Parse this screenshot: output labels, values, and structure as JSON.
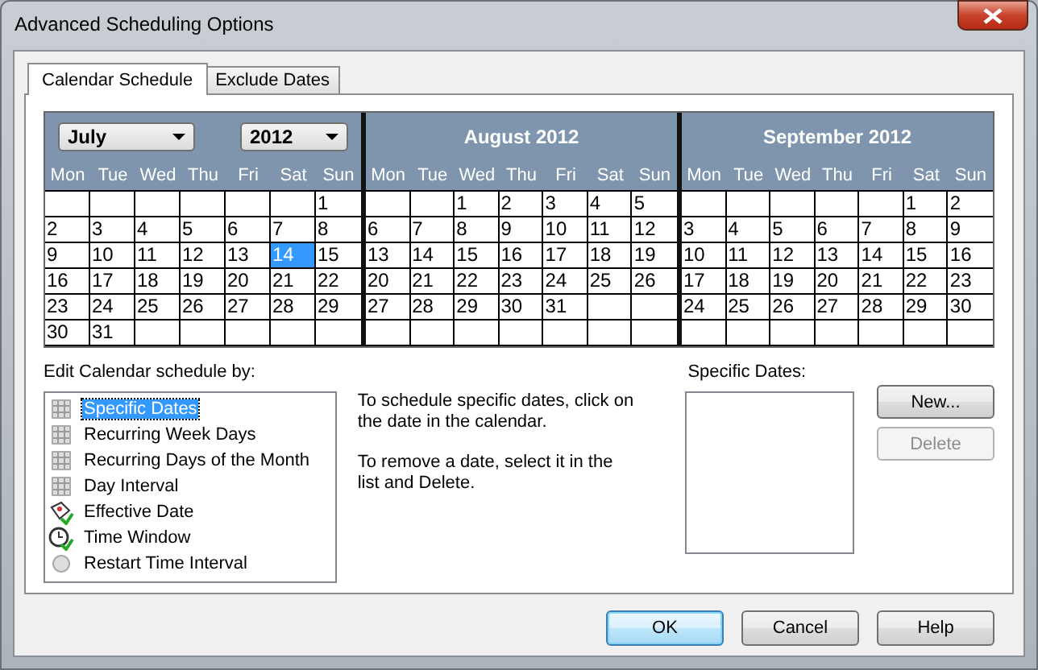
{
  "window": {
    "title": "Advanced Scheduling Options"
  },
  "tabs": [
    {
      "label": "Calendar Schedule",
      "selected": true
    },
    {
      "label": "Exclude Dates",
      "selected": false
    }
  ],
  "calendar": {
    "months": [
      {
        "kind": "dropdowns",
        "month_select": "July",
        "year_select": "2012",
        "weekdays": [
          "Mon",
          "Tue",
          "Wed",
          "Thu",
          "Fri",
          "Sat",
          "Sun"
        ],
        "weeks": [
          [
            {
              "kind": "blank"
            },
            {
              "kind": "blank"
            },
            {
              "kind": "blank"
            },
            {
              "kind": "blank"
            },
            {
              "kind": "blank"
            },
            {
              "kind": "blank"
            },
            {
              "kind": "day",
              "day": "1",
              "selected": false
            }
          ],
          [
            {
              "kind": "day",
              "day": "2",
              "selected": false
            },
            {
              "kind": "day",
              "day": "3",
              "selected": false
            },
            {
              "kind": "day",
              "day": "4",
              "selected": false
            },
            {
              "kind": "day",
              "day": "5",
              "selected": false
            },
            {
              "kind": "day",
              "day": "6",
              "selected": false
            },
            {
              "kind": "day",
              "day": "7",
              "selected": false
            },
            {
              "kind": "day",
              "day": "8",
              "selected": false
            }
          ],
          [
            {
              "kind": "day",
              "day": "9",
              "selected": false
            },
            {
              "kind": "day",
              "day": "10",
              "selected": false
            },
            {
              "kind": "day",
              "day": "11",
              "selected": false
            },
            {
              "kind": "day",
              "day": "12",
              "selected": false
            },
            {
              "kind": "day",
              "day": "13",
              "selected": false
            },
            {
              "kind": "day",
              "day": "14",
              "selected": true
            },
            {
              "kind": "day",
              "day": "15",
              "selected": false
            }
          ],
          [
            {
              "kind": "day",
              "day": "16",
              "selected": false
            },
            {
              "kind": "day",
              "day": "17",
              "selected": false
            },
            {
              "kind": "day",
              "day": "18",
              "selected": false
            },
            {
              "kind": "day",
              "day": "19",
              "selected": false
            },
            {
              "kind": "day",
              "day": "20",
              "selected": false
            },
            {
              "kind": "day",
              "day": "21",
              "selected": false
            },
            {
              "kind": "day",
              "day": "22",
              "selected": false
            }
          ],
          [
            {
              "kind": "day",
              "day": "23",
              "selected": false
            },
            {
              "kind": "day",
              "day": "24",
              "selected": false
            },
            {
              "kind": "day",
              "day": "25",
              "selected": false
            },
            {
              "kind": "day",
              "day": "26",
              "selected": false
            },
            {
              "kind": "day",
              "day": "27",
              "selected": false
            },
            {
              "kind": "day",
              "day": "28",
              "selected": false
            },
            {
              "kind": "day",
              "day": "29",
              "selected": false
            }
          ],
          [
            {
              "kind": "day",
              "day": "30",
              "selected": false
            },
            {
              "kind": "day",
              "day": "31",
              "selected": false
            },
            {
              "kind": "blank"
            },
            {
              "kind": "blank"
            },
            {
              "kind": "blank"
            },
            {
              "kind": "blank"
            },
            {
              "kind": "blank"
            }
          ]
        ]
      },
      {
        "kind": "title",
        "title": "August 2012",
        "weekdays": [
          "Mon",
          "Tue",
          "Wed",
          "Thu",
          "Fri",
          "Sat",
          "Sun"
        ],
        "weeks": [
          [
            {
              "kind": "blank"
            },
            {
              "kind": "blank"
            },
            {
              "kind": "day",
              "day": "1",
              "selected": false
            },
            {
              "kind": "day",
              "day": "2",
              "selected": false
            },
            {
              "kind": "day",
              "day": "3",
              "selected": false
            },
            {
              "kind": "day",
              "day": "4",
              "selected": false
            },
            {
              "kind": "day",
              "day": "5",
              "selected": false
            }
          ],
          [
            {
              "kind": "day",
              "day": "6",
              "selected": false
            },
            {
              "kind": "day",
              "day": "7",
              "selected": false
            },
            {
              "kind": "day",
              "day": "8",
              "selected": false
            },
            {
              "kind": "day",
              "day": "9",
              "selected": false
            },
            {
              "kind": "day",
              "day": "10",
              "selected": false
            },
            {
              "kind": "day",
              "day": "11",
              "selected": false
            },
            {
              "kind": "day",
              "day": "12",
              "selected": false
            }
          ],
          [
            {
              "kind": "day",
              "day": "13",
              "selected": false
            },
            {
              "kind": "day",
              "day": "14",
              "selected": false
            },
            {
              "kind": "day",
              "day": "15",
              "selected": false
            },
            {
              "kind": "day",
              "day": "16",
              "selected": false
            },
            {
              "kind": "day",
              "day": "17",
              "selected": false
            },
            {
              "kind": "day",
              "day": "18",
              "selected": false
            },
            {
              "kind": "day",
              "day": "19",
              "selected": false
            }
          ],
          [
            {
              "kind": "day",
              "day": "20",
              "selected": false
            },
            {
              "kind": "day",
              "day": "21",
              "selected": false
            },
            {
              "kind": "day",
              "day": "22",
              "selected": false
            },
            {
              "kind": "day",
              "day": "23",
              "selected": false
            },
            {
              "kind": "day",
              "day": "24",
              "selected": false
            },
            {
              "kind": "day",
              "day": "25",
              "selected": false
            },
            {
              "kind": "day",
              "day": "26",
              "selected": false
            }
          ],
          [
            {
              "kind": "day",
              "day": "27",
              "selected": false
            },
            {
              "kind": "day",
              "day": "28",
              "selected": false
            },
            {
              "kind": "day",
              "day": "29",
              "selected": false
            },
            {
              "kind": "day",
              "day": "30",
              "selected": false
            },
            {
              "kind": "day",
              "day": "31",
              "selected": false
            },
            {
              "kind": "blank"
            },
            {
              "kind": "blank"
            }
          ],
          [
            {
              "kind": "blank"
            },
            {
              "kind": "blank"
            },
            {
              "kind": "blank"
            },
            {
              "kind": "blank"
            },
            {
              "kind": "blank"
            },
            {
              "kind": "blank"
            },
            {
              "kind": "blank"
            }
          ]
        ]
      },
      {
        "kind": "title",
        "title": "September 2012",
        "weekdays": [
          "Mon",
          "Tue",
          "Wed",
          "Thu",
          "Fri",
          "Sat",
          "Sun"
        ],
        "weeks": [
          [
            {
              "kind": "blank"
            },
            {
              "kind": "blank"
            },
            {
              "kind": "blank"
            },
            {
              "kind": "blank"
            },
            {
              "kind": "blank"
            },
            {
              "kind": "day",
              "day": "1",
              "selected": false
            },
            {
              "kind": "day",
              "day": "2",
              "selected": false
            }
          ],
          [
            {
              "kind": "day",
              "day": "3",
              "selected": false
            },
            {
              "kind": "day",
              "day": "4",
              "selected": false
            },
            {
              "kind": "day",
              "day": "5",
              "selected": false
            },
            {
              "kind": "day",
              "day": "6",
              "selected": false
            },
            {
              "kind": "day",
              "day": "7",
              "selected": false
            },
            {
              "kind": "day",
              "day": "8",
              "selected": false
            },
            {
              "kind": "day",
              "day": "9",
              "selected": false
            }
          ],
          [
            {
              "kind": "day",
              "day": "10",
              "selected": false
            },
            {
              "kind": "day",
              "day": "11",
              "selected": false
            },
            {
              "kind": "day",
              "day": "12",
              "selected": false
            },
            {
              "kind": "day",
              "day": "13",
              "selected": false
            },
            {
              "kind": "day",
              "day": "14",
              "selected": false
            },
            {
              "kind": "day",
              "day": "15",
              "selected": false
            },
            {
              "kind": "day",
              "day": "16",
              "selected": false
            }
          ],
          [
            {
              "kind": "day",
              "day": "17",
              "selected": false
            },
            {
              "kind": "day",
              "day": "18",
              "selected": false
            },
            {
              "kind": "day",
              "day": "19",
              "selected": false
            },
            {
              "kind": "day",
              "day": "20",
              "selected": false
            },
            {
              "kind": "day",
              "day": "21",
              "selected": false
            },
            {
              "kind": "day",
              "day": "22",
              "selected": false
            },
            {
              "kind": "day",
              "day": "23",
              "selected": false
            }
          ],
          [
            {
              "kind": "day",
              "day": "24",
              "selected": false
            },
            {
              "kind": "day",
              "day": "25",
              "selected": false
            },
            {
              "kind": "day",
              "day": "26",
              "selected": false
            },
            {
              "kind": "day",
              "day": "27",
              "selected": false
            },
            {
              "kind": "day",
              "day": "28",
              "selected": false
            },
            {
              "kind": "day",
              "day": "29",
              "selected": false
            },
            {
              "kind": "day",
              "day": "30",
              "selected": false
            }
          ],
          [
            {
              "kind": "blank"
            },
            {
              "kind": "blank"
            },
            {
              "kind": "blank"
            },
            {
              "kind": "blank"
            },
            {
              "kind": "blank"
            },
            {
              "kind": "blank"
            },
            {
              "kind": "blank"
            }
          ]
        ]
      }
    ]
  },
  "schedule_by": {
    "label": "Edit Calendar schedule by:",
    "items": [
      {
        "label": "Specific Dates",
        "kind": "grid",
        "selected": true
      },
      {
        "label": "Recurring Week Days",
        "kind": "grid",
        "selected": false
      },
      {
        "label": "Recurring Days of the Month",
        "kind": "grid",
        "selected": false
      },
      {
        "label": "Day Interval",
        "kind": "grid",
        "selected": false
      },
      {
        "label": "Effective Date",
        "kind": "calendar",
        "selected": false
      },
      {
        "label": "Time Window",
        "kind": "clock",
        "selected": false
      },
      {
        "label": "Restart Time Interval",
        "kind": "interval",
        "selected": false
      }
    ]
  },
  "instructions": [
    "To schedule specific dates, click on the date in the calendar.",
    "To remove a date, select it in the list and Delete."
  ],
  "specific_dates": {
    "label": "Specific Dates:"
  },
  "side_buttons": [
    {
      "label": "New...",
      "disabled": false
    },
    {
      "label": "Delete",
      "disabled": true
    }
  ],
  "footer_buttons": [
    {
      "label": "OK",
      "default": true
    },
    {
      "label": "Cancel",
      "default": false
    },
    {
      "label": "Help",
      "default": false
    }
  ]
}
